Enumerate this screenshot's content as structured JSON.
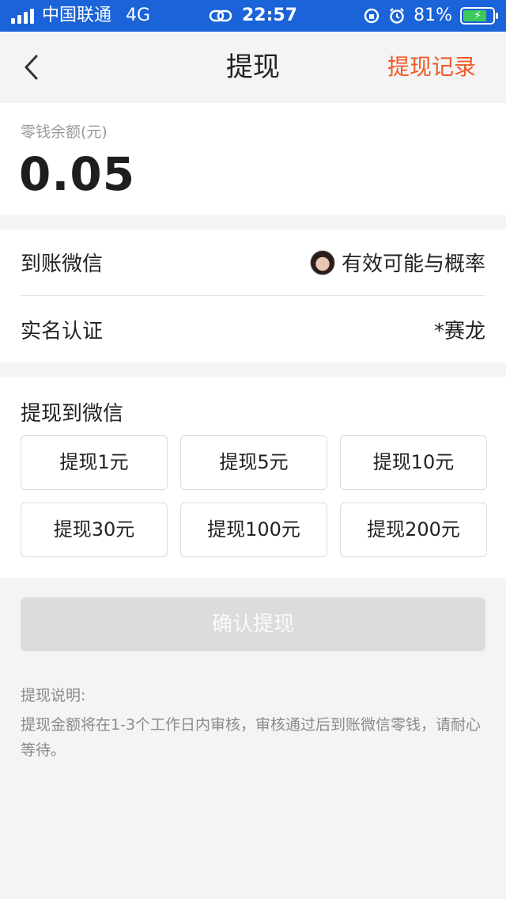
{
  "status_bar": {
    "carrier": "中国联通",
    "network": "4G",
    "time": "22:57",
    "battery": "81%",
    "battery_level": 0.81
  },
  "nav": {
    "title": "提现",
    "right_link": "提现记录"
  },
  "balance": {
    "label": "零钱余额(元)",
    "amount": "0.05"
  },
  "account": {
    "wechat_label": "到账微信",
    "wechat_name": "有效可能与概率",
    "realname_label": "实名认证",
    "realname_value": "*赛龙"
  },
  "withdraw": {
    "title": "提现到微信",
    "options": [
      "提现1元",
      "提现5元",
      "提现10元",
      "提现30元",
      "提现100元",
      "提现200元"
    ]
  },
  "confirm_label": "确认提现",
  "notes": {
    "title": "提现说明:",
    "text": "提现金额将在1-3个工作日内审核，审核通过后到账微信零钱，请耐心等待。"
  },
  "colors": {
    "status_bar": "#1a63d8",
    "accent": "#f05a28",
    "disabled_button": "#dcdcdc"
  }
}
